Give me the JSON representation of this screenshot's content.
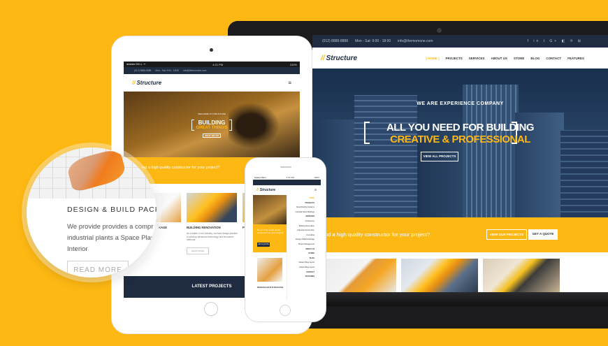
{
  "brand": {
    "logo_text": "Structure",
    "accent": "#fdb813",
    "dark": "#1e2b40"
  },
  "laptop": {
    "topbar": {
      "phone": "(012) 8888-8888",
      "hours": "Mon - Sat: 9:00 - 18:00",
      "email": "info@themomone.com",
      "social": "f in t G+ ◧ ℗ ⊞"
    },
    "nav": [
      "[ HOME ]",
      "PROJECTS",
      "SERVICES",
      "ABOUT US",
      "STORE",
      "BLOG",
      "CONTACT",
      "FEATURES"
    ],
    "hero": {
      "eyebrow": "WE ARE EXPERIENCE COMPANY",
      "line1": "ALL YOU NEED FOR BUILDING",
      "line2": "CREATIVE & PROFESSIONAL",
      "button": "VIEW ALL PROJECTS"
    },
    "strip": {
      "text": "you find a high quality constructor for your project?",
      "btn_projects": "VIEW OUR PROJECTS",
      "btn_quote": "GET A QUOTE"
    }
  },
  "tablet": {
    "status": {
      "carrier": "●●●●● BELL ᯤ",
      "time": "4:21 PM",
      "battery": "100%"
    },
    "topbar": {
      "phone": "(012) 8888-8888",
      "hours": "Mon - Sat: 9:00 - 18:00",
      "email": "info@themomone.com"
    },
    "hero": {
      "small": "WELCOME TO STRUCTURE",
      "line1": "BUILDING",
      "line2": "GREAT THINGS",
      "button": "WHAT WE DO"
    },
    "strip_text": "ind a high quality constructor for your project?",
    "cards": [
      {
        "title": "KAGE",
        "text": ""
      },
      {
        "title": "BUILDING RENOVATION",
        "text": "As a leader in our industry, we have design practice to develop advanced technology and innovation methods.",
        "button": "READ MORE"
      },
      {
        "title": "PR",
        "text": ""
      }
    ],
    "footer": "LATEST PROJECTS"
  },
  "phone": {
    "status": {
      "carrier": "●●●●● BELL",
      "time": "4:21 PM",
      "battery": "100%"
    },
    "menu": [
      "HOME",
      "PROJECTS",
      "Metal Roofing Systems",
      "Industrial Steel Buildings",
      "SERVICES",
      "Architecture",
      "Building Renovation",
      "Industrial Construction",
      "Consulting",
      "Design & Build Package",
      "Project Management",
      "ABOUT US",
      "STORE",
      "BLOG",
      "Modern Blog Layout",
      "Classic Blog Layout",
      "CONTACT",
      "FEATURES"
    ],
    "side_card": "DESIGN & BUILD PACKAGE",
    "hero_text": "Do you find a high quality constructor for your project?",
    "hero_btn": "GET A QUOTE"
  },
  "magnifier": {
    "title": "DESIGN & BUILD PACKAG",
    "text": "We provide  provides a compr services for industrial plants a Space Planners and Interior",
    "button": "READ MORE"
  }
}
